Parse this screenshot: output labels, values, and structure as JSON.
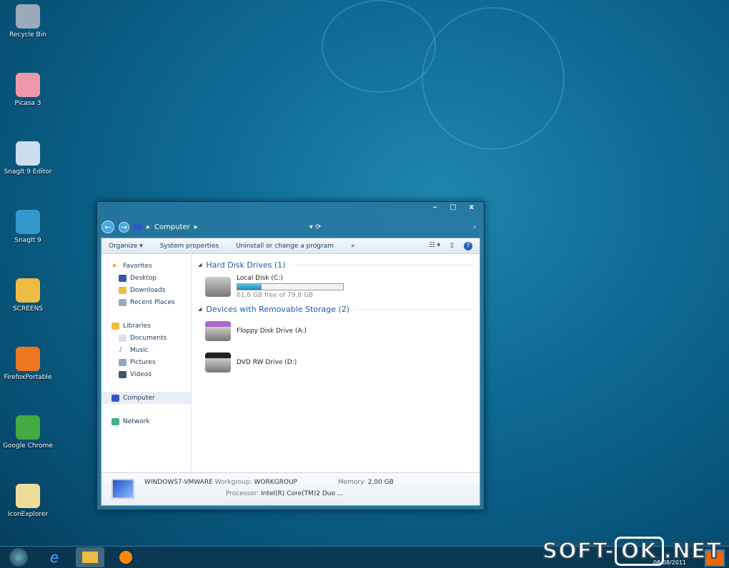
{
  "desktop": {
    "icons": [
      {
        "label": "Recycle Bin",
        "color": "#9ab"
      },
      {
        "label": "Picasa 3",
        "color": "#e9a"
      },
      {
        "label": "SnagIt 9 Editor",
        "color": "#cde"
      },
      {
        "label": "SnagIt 9",
        "color": "#39c"
      },
      {
        "label": "SCREENS",
        "color": "#eb4"
      },
      {
        "label": "FirefoxPortable",
        "color": "#e72"
      },
      {
        "label": "Google Chrome",
        "color": "#4a4"
      },
      {
        "label": "IconExplorer",
        "color": "#ed9"
      }
    ]
  },
  "window": {
    "controls": [
      "–",
      "□",
      "x"
    ],
    "breadcrumb": [
      "Computer"
    ],
    "cmdbar": {
      "organize": "Organize ▾",
      "system_properties": "System properties",
      "uninstall": "Uninstall or change a program",
      "more": "»"
    },
    "nav": {
      "favorites": "Favorites",
      "fav_items": [
        "Desktop",
        "Downloads",
        "Recent Places"
      ],
      "libraries": "Libraries",
      "lib_items": [
        "Documents",
        "Music",
        "Pictures",
        "Videos"
      ],
      "computer": "Computer",
      "network": "Network"
    },
    "sections": {
      "hdd": "Hard Disk Drives (1)",
      "removable": "Devices with Removable Storage (2)"
    },
    "drives": {
      "c_name": "Local Disk (C:)",
      "c_free": "61,6 GB free of 79,8 GB",
      "c_used_percent": 22.8,
      "floppy": "Floppy Disk Drive (A:)",
      "dvd": "DVD RW Drive (D:)"
    },
    "details": {
      "name": "WINDOWS7-VMWARE",
      "workgroup_label": "Workgroup:",
      "workgroup": "WORKGROUP",
      "memory_label": "Memory:",
      "memory": "2,00 GB",
      "processor_label": "Processor:",
      "processor": "Intel(R) Core(TM)2 Duo ..."
    }
  },
  "taskbar": {
    "clock_date": "08/08/2011"
  },
  "watermark": {
    "left": "SOFT-",
    "mid": "OK",
    "right": ".NET"
  }
}
